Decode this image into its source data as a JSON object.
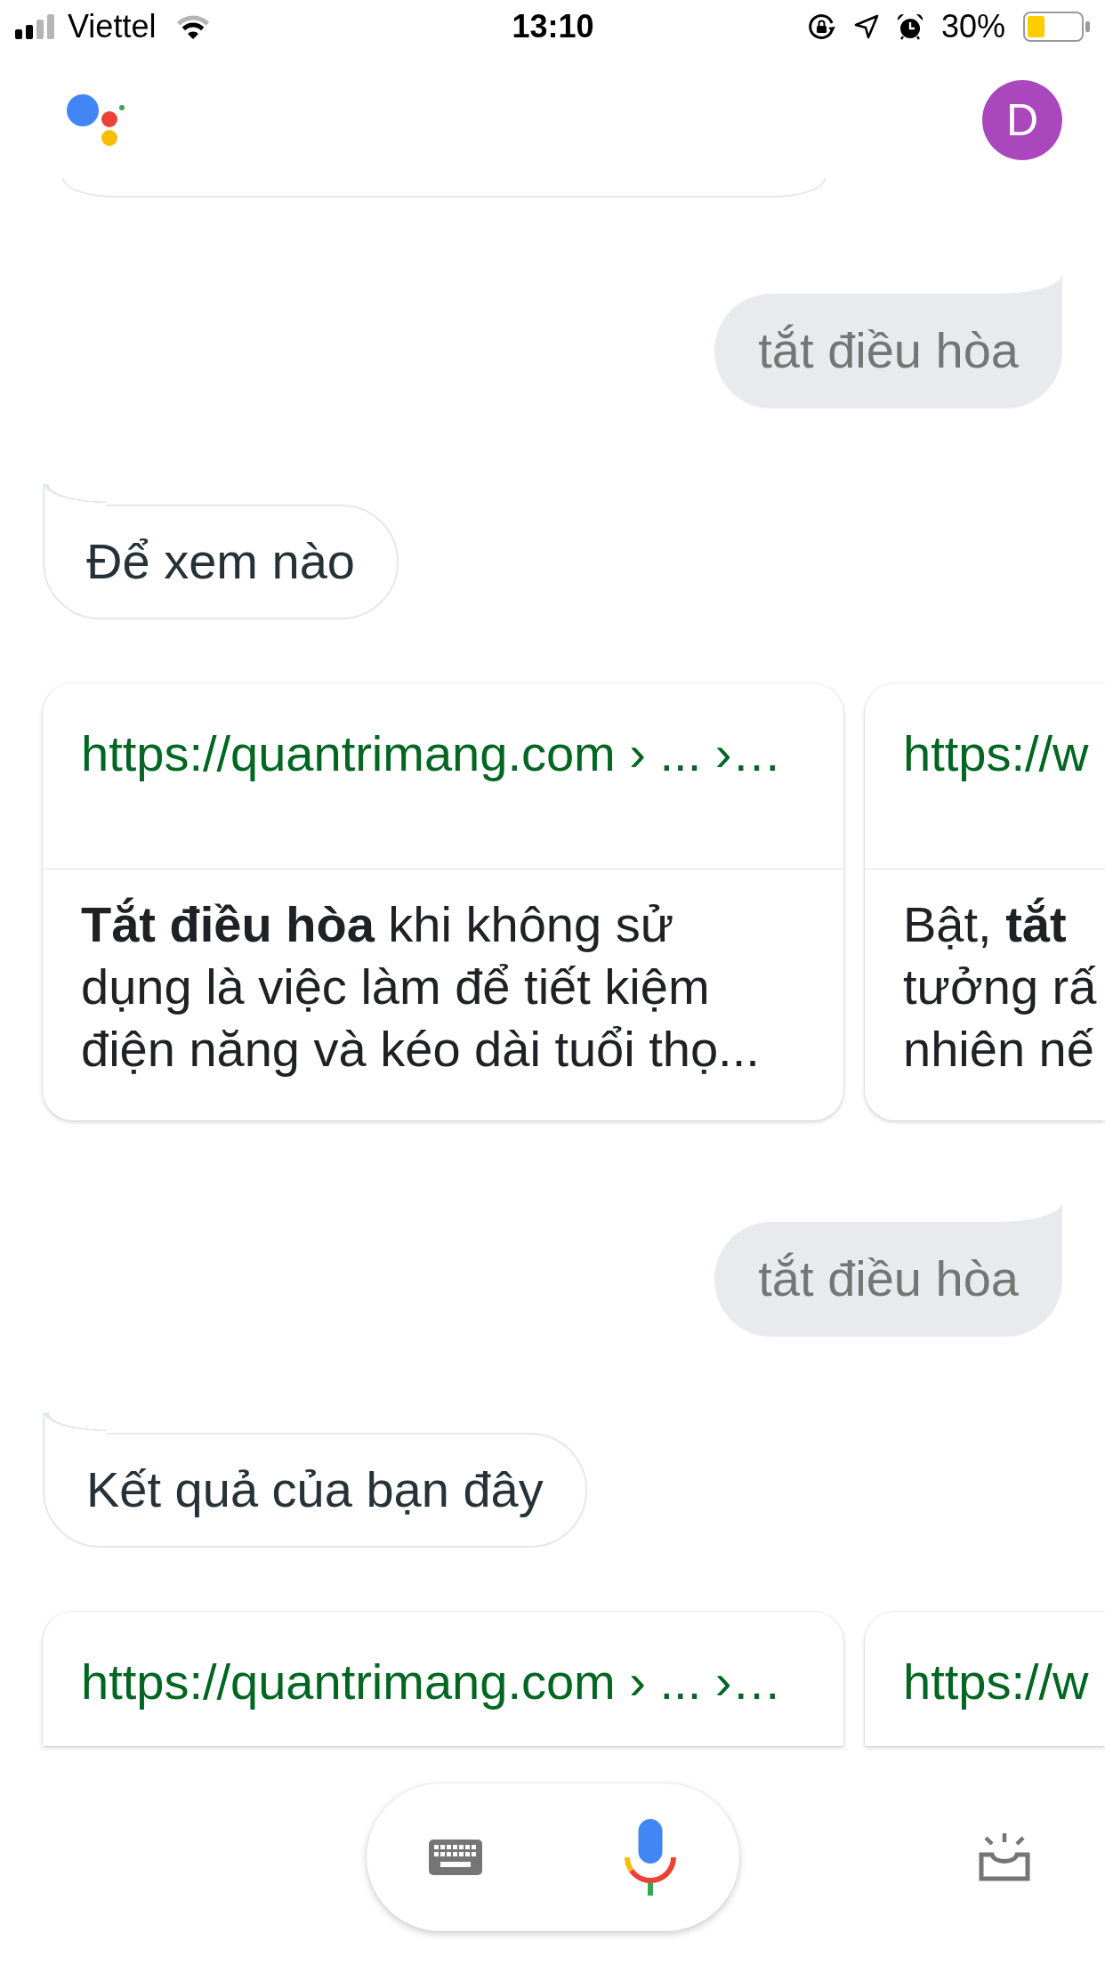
{
  "status_bar": {
    "carrier": "Viettel",
    "time": "13:10",
    "battery": "30%"
  },
  "header": {
    "avatar_letter": "D"
  },
  "conversation": [
    {
      "kind": "bubble_edge"
    },
    {
      "kind": "user",
      "text": "tắt điều hòa"
    },
    {
      "kind": "assistant",
      "text": "Để xem nào"
    },
    {
      "kind": "cards",
      "cards": [
        {
          "url": "https://quantrimang.com › ... ›…",
          "snippet": "**Tắt điều hòa** khi không sử\ndụng là việc làm để tiết kiệm\nđiện năng và kéo dài tuổi thọ..."
        },
        {
          "url": "https://w",
          "snippet": "Bật, **tắt**\ntưởng rấ\nnhiên nế"
        }
      ]
    },
    {
      "kind": "user",
      "text": "tắt điều hòa"
    },
    {
      "kind": "assistant",
      "text": "Kết quả của bạn đây"
    },
    {
      "kind": "cards",
      "cards": [
        {
          "url": "https://quantrimang.com › ... ›…"
        },
        {
          "url": "https://w"
        }
      ]
    }
  ]
}
